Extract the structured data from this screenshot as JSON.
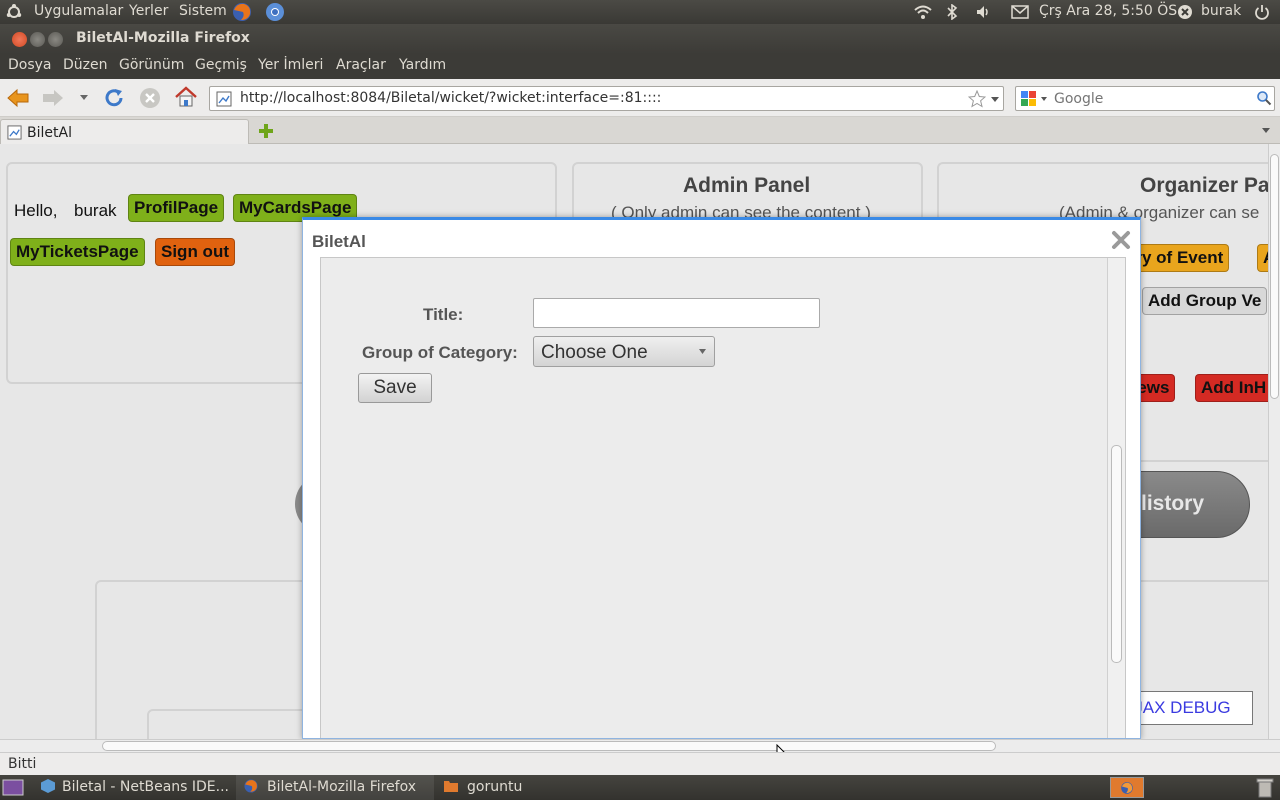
{
  "top_panel": {
    "menus": [
      "Uygulamalar",
      "Yerler",
      "Sistem"
    ],
    "datetime": "Çrş Ara 28,  5:50 ÖS",
    "user": "burak",
    "icons": [
      "ubuntu-logo-icon",
      "firefox-icon",
      "chromium-icon",
      "wifi-icon",
      "bluetooth-icon",
      "volume-icon",
      "mail-icon",
      "user-icon",
      "power-icon"
    ]
  },
  "window": {
    "title": "BiletAl-Mozilla Firefox"
  },
  "menubar": [
    "Dosya",
    "Düzen",
    "Görünüm",
    "Geçmiş",
    "Yer İmleri",
    "Araçlar",
    "Yardım"
  ],
  "navbar": {
    "url": "http://localhost:8084/Biletal/wicket/?wicket:interface=:81::::",
    "search_placeholder": "Google"
  },
  "tabs": [
    {
      "label": "BiletAl"
    }
  ],
  "page": {
    "user_panel": {
      "greeting": "Hello,",
      "username": "burak",
      "buttons": [
        "ProfilPage",
        "MyCardsPage",
        "MyTicketsPage",
        "Sign out"
      ]
    },
    "admin_panel": {
      "title": "Admin Panel",
      "subtitle": "( Only admin can see the content )"
    },
    "organizer_panel": {
      "title": "Organizer Pa",
      "subtitle": "(Admin & organizer can se",
      "buttons": [
        "ory of Event",
        "A",
        "Add Group Ve",
        "News",
        "Add InH"
      ]
    },
    "history_button": "listory"
  },
  "modal": {
    "title": "BiletAl",
    "fields": {
      "title_label": "Title:",
      "title_value": "",
      "category_label": "Group of Category:",
      "category_value": "Choose One"
    },
    "save_label": "Save"
  },
  "debug_link": "WICKET AJAX DEBUG",
  "status": "Bitti",
  "taskbar": {
    "items": [
      "Biletal - NetBeans IDE...",
      "BiletAl-Mozilla Firefox",
      "goruntu"
    ]
  },
  "colors": {
    "green": "#7fb01a",
    "orange": "#e0620f",
    "amber": "#e9a51d",
    "red": "#d42a23",
    "modal_accent": "#3a8ae6",
    "debug_link": "#3a3ae0"
  }
}
